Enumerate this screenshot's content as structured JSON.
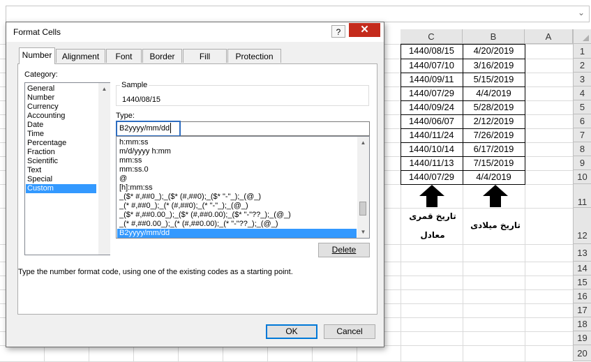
{
  "sheet": {
    "columns": [
      "C",
      "B",
      "A"
    ],
    "rows": [
      "1",
      "2",
      "3",
      "4",
      "5",
      "6",
      "7",
      "8",
      "9",
      "10",
      "11",
      "12",
      "13",
      "14",
      "15",
      "16",
      "17",
      "18",
      "19",
      "20"
    ],
    "data": [
      {
        "hijri": "1440/08/15",
        "gregorian": "4/20/2019"
      },
      {
        "hijri": "1440/07/10",
        "gregorian": "3/16/2019"
      },
      {
        "hijri": "1440/09/11",
        "gregorian": "5/15/2019"
      },
      {
        "hijri": "1440/07/29",
        "gregorian": "4/4/2019"
      },
      {
        "hijri": "1440/09/24",
        "gregorian": "5/28/2019"
      },
      {
        "hijri": "1440/06/07",
        "gregorian": "2/12/2019"
      },
      {
        "hijri": "1440/11/24",
        "gregorian": "7/26/2019"
      },
      {
        "hijri": "1440/10/14",
        "gregorian": "6/17/2019"
      },
      {
        "hijri": "1440/11/13",
        "gregorian": "7/15/2019"
      },
      {
        "hijri": "1440/07/29",
        "gregorian": "4/4/2019"
      }
    ],
    "label_hijri_line1": "تاریخ قمری",
    "label_hijri_line2": "معادل",
    "label_gregorian": "تاریخ میلادی"
  },
  "dialog": {
    "title": "Format Cells",
    "help": "?",
    "close": "✕",
    "tabs": [
      "Number",
      "Alignment",
      "Font",
      "Border",
      "Fill",
      "Protection"
    ],
    "category_label": "Category:",
    "categories": [
      "General",
      "Number",
      "Currency",
      "Accounting",
      "Date",
      "Time",
      "Percentage",
      "Fraction",
      "Scientific",
      "Text",
      "Special",
      "Custom"
    ],
    "selected_category": "Custom",
    "sample_label": "Sample",
    "sample_value": "1440/08/15",
    "type_label": "Type:",
    "type_value": "B2yyyy/mm/dd",
    "formats": [
      "h:mm:ss",
      "m/d/yyyy h:mm",
      "mm:ss",
      "mm:ss.0",
      "@",
      "[h]:mm:ss",
      "_($* #,##0_);_($* (#,##0);_($* \"-\"_);_(@_)",
      "_(* #,##0_);_(* (#,##0);_(* \"-\"_);_(@_)",
      "_($* #,##0.00_);_($* (#,##0.00);_($* \"-\"??_);_(@_)",
      "_(* #,##0.00_);_(* (#,##0.00);_(* \"-\"??_);_(@_)",
      "B2yyyy/mm/dd"
    ],
    "delete_label": "Delete",
    "help_text": "Type the number format code, using one of the existing codes as a starting point.",
    "ok_label": "OK",
    "cancel_label": "Cancel"
  },
  "colors": {
    "selection": "#3399ff",
    "close_button": "#c42b1c",
    "focus": "#2e6dc0"
  },
  "icons": [
    "help-icon",
    "close-icon",
    "scroll-up-icon",
    "scroll-down-icon",
    "down-arrow-icon",
    "chevron-down-icon"
  ]
}
